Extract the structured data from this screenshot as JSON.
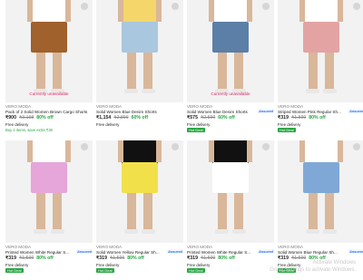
{
  "products": [
    {
      "brand": "VERO MODA",
      "name": "Pack of 2 Solid Women Brown Cargo Shorts",
      "price": "₹900",
      "mrp": "₹3,198",
      "off": "80% off",
      "delivery": "Free delivery",
      "status": "Currently unavailable",
      "extra": "Buy 2 items, save extra ₹30",
      "assured": "",
      "hot": "",
      "colors": {
        "top": "#ffffff",
        "shorts": "#a0612c"
      }
    },
    {
      "brand": "VERO MODA",
      "name": "Solid Women Blue Denim Shorts",
      "price": "₹1,154",
      "mrp": "₹2,899",
      "off": "60% off",
      "delivery": "Free delivery",
      "status": "",
      "extra": "",
      "assured": "",
      "hot": "",
      "colors": {
        "top": "#f4d66b",
        "shorts": "#a9c7df"
      }
    },
    {
      "brand": "VERO MODA",
      "name": "Solid Women Blue Denim Shorts",
      "price": "₹575",
      "mrp": "₹2,599",
      "off": "60% off",
      "delivery": "Free delivery",
      "status": "Currently unavailable",
      "extra": "",
      "assured": "Assured",
      "hot": "Hot Deal",
      "colors": {
        "top": "#ffffff",
        "shorts": "#5b7fa6"
      }
    },
    {
      "brand": "VERO MODA",
      "name": "Striped Women Pink Regular Sh...",
      "price": "₹319",
      "mrp": "₹1,599",
      "off": "80% off",
      "delivery": "Free delivery",
      "status": "",
      "extra": "",
      "assured": "Assured",
      "hot": "Hot Deal",
      "colors": {
        "top": "#ffffff",
        "shorts": "#e3a3a3"
      }
    },
    {
      "brand": "VERO MODA",
      "name": "Printed Women White Regular S...",
      "price": "₹319",
      "mrp": "₹1,599",
      "off": "80% off",
      "delivery": "Free delivery",
      "status": "",
      "extra": "",
      "assured": "Assured",
      "hot": "Hot Deal",
      "colors": {
        "top": "#ffffff",
        "shorts": "#e6a6d9"
      }
    },
    {
      "brand": "VERO MODA",
      "name": "Solid Women Yellow Regular Sh...",
      "price": "₹319",
      "mrp": "₹1,599",
      "off": "80% off",
      "delivery": "Free delivery",
      "status": "",
      "extra": "",
      "assured": "Assured",
      "hot": "Hot Deal",
      "colors": {
        "top": "#111111",
        "shorts": "#f2e04a"
      }
    },
    {
      "brand": "VERO MODA",
      "name": "Printed Women White Regular S...",
      "price": "₹319",
      "mrp": "₹1,599",
      "off": "80% off",
      "delivery": "Free delivery",
      "status": "",
      "extra": "",
      "assured": "Assured",
      "hot": "Hot Deal",
      "colors": {
        "top": "#111111",
        "shorts": "#ffffff"
      }
    },
    {
      "brand": "VERO MODA",
      "name": "Solid Women Blue Regular Sh...",
      "price": "₹319",
      "mrp": "₹1,599",
      "off": "80% off",
      "delivery": "Free delivery",
      "status": "",
      "extra": "",
      "assured": "Assured",
      "hot": "Hot Deal",
      "colors": {
        "top": "#ffffff",
        "shorts": "#7fa8d6"
      }
    }
  ],
  "watermark": {
    "line1": "Activate Windows",
    "line2": "Go to Settings to activate Windows."
  }
}
